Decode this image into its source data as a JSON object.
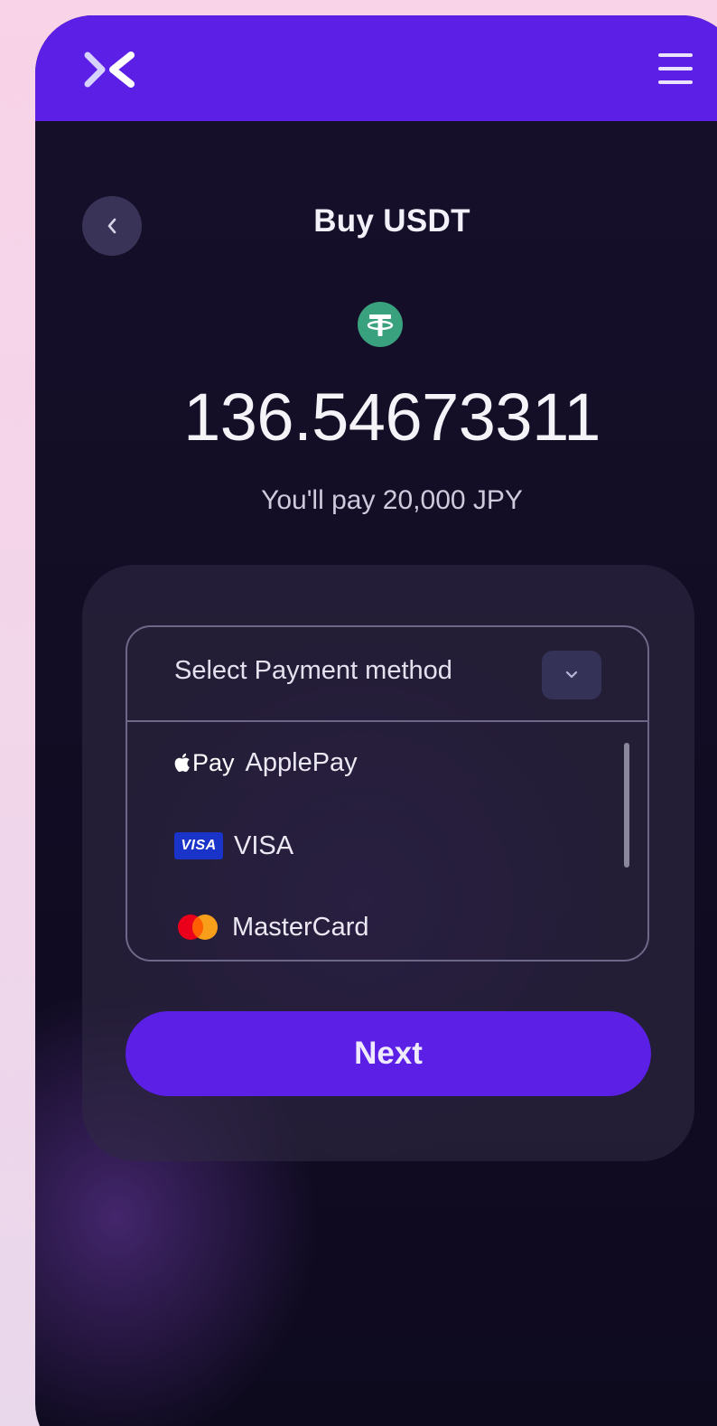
{
  "header": {
    "logo_icon": "x-logo-icon",
    "menu_icon": "hamburger-menu-icon",
    "brand_color": "#5b1fe6"
  },
  "page": {
    "back_icon": "chevron-left-icon",
    "title": "Buy USDT",
    "coin_icon": "tether-icon",
    "coin_color": "#3aa17e",
    "amount": "136.54673311",
    "pay_note": "You'll pay 20,000 JPY"
  },
  "payment": {
    "placeholder": "Select Payment method",
    "chevron_icon": "chevron-down-icon",
    "options": [
      {
        "brand_mark": "Pay",
        "label": "ApplePay",
        "icon": "apple-pay-icon"
      },
      {
        "brand_mark": "VISA",
        "label": "VISA",
        "icon": "visa-icon"
      },
      {
        "brand_mark": "",
        "label": "MasterCard",
        "icon": "mastercard-icon"
      }
    ]
  },
  "actions": {
    "next_label": "Next"
  }
}
